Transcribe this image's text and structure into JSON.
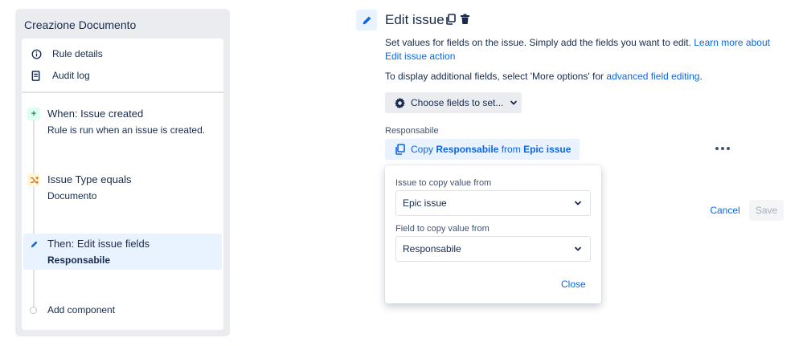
{
  "sidebar": {
    "title": "Creazione Documento",
    "menu": [
      {
        "label": "Rule details",
        "icon": "info-icon"
      },
      {
        "label": "Audit log",
        "icon": "audit-log-icon"
      }
    ],
    "steps": [
      {
        "badge": "+",
        "title": "When: Issue created",
        "subtitle": "Rule is run when an issue is created."
      },
      {
        "badge": "shuffle",
        "title": "Issue Type equals",
        "subtitle": "Documento"
      },
      {
        "badge": "pencil",
        "title": "Then: Edit issue fields",
        "subtitle": "Responsabile"
      }
    ],
    "add_component": "Add component"
  },
  "header": {
    "title": "Edit issue"
  },
  "description": {
    "text": "Set values for fields on the issue. Simply add the fields you want to edit. ",
    "link": "Learn more about Edit issue action",
    "line2_prefix": "To display additional fields, select 'More options' for ",
    "line2_link": "advanced field editing",
    "line2_suffix": "."
  },
  "choose_fields": {
    "label": "Choose fields to set..."
  },
  "field": {
    "label": "Responsabile",
    "chip_prefix": "Copy ",
    "chip_field": "Responsabile",
    "chip_mid": " from ",
    "chip_source": "Epic issue"
  },
  "popup": {
    "issue_label": "Issue to copy value from",
    "issue_value": "Epic issue",
    "field_label": "Field to copy value from",
    "field_value": "Responsabile",
    "close": "Close"
  },
  "actions": {
    "cancel": "Cancel",
    "save": "Save"
  },
  "colors": {
    "accent": "#0c66e4",
    "trigger_badge": "#dcfff1",
    "condition_badge": "#fff7d6",
    "action_badge": "#e9f2ff"
  }
}
